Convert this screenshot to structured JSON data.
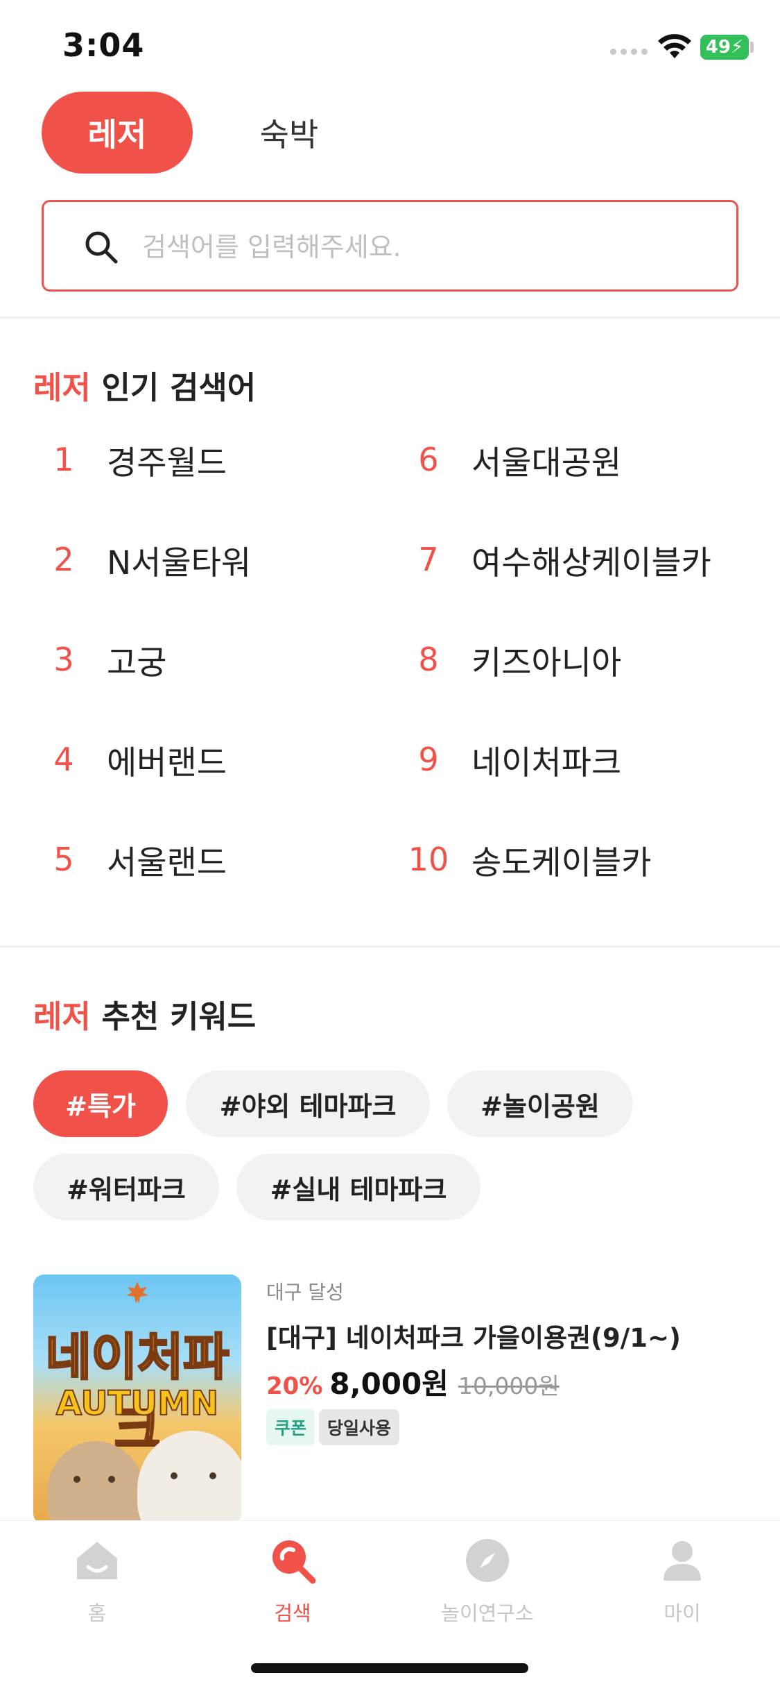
{
  "status_bar": {
    "time": "3:04",
    "battery": "49"
  },
  "top_tabs": [
    {
      "label": "레저",
      "active": true
    },
    {
      "label": "숙박",
      "active": false
    }
  ],
  "search": {
    "placeholder": "검색어를 입력해주세요.",
    "value": ""
  },
  "popular": {
    "title_accent": "레저",
    "title_rest": " 인기 검색어",
    "items": [
      {
        "rank": "1",
        "label": "경주월드"
      },
      {
        "rank": "2",
        "label": "N서울타워"
      },
      {
        "rank": "3",
        "label": "고궁"
      },
      {
        "rank": "4",
        "label": "에버랜드"
      },
      {
        "rank": "5",
        "label": "서울랜드"
      },
      {
        "rank": "6",
        "label": "서울대공원"
      },
      {
        "rank": "7",
        "label": "여수해상케이블카"
      },
      {
        "rank": "8",
        "label": "키즈아니아"
      },
      {
        "rank": "9",
        "label": "네이처파크"
      },
      {
        "rank": "10",
        "label": "송도케이블카"
      }
    ]
  },
  "recommend": {
    "title_accent": "레저",
    "title_rest": " 추천 키워드",
    "chips": [
      {
        "label": "#특가",
        "active": true
      },
      {
        "label": "#야외 테마파크",
        "active": false
      },
      {
        "label": "#놀이공원",
        "active": false
      },
      {
        "label": "#워터파크",
        "active": false
      },
      {
        "label": "#실내 테마파크",
        "active": false
      }
    ]
  },
  "product": {
    "thumb_title": "네이처파크",
    "thumb_subtitle": "AUTUMN",
    "location": "대구 달성",
    "title": "[대구] 네이처파크 가을이용권(9/1~)",
    "discount": "20%",
    "price": "8,000원",
    "original_price": "10,000원",
    "tags": [
      "쿠폰",
      "당일사용"
    ]
  },
  "bottom_nav": [
    {
      "label": "홈",
      "icon": "home-icon",
      "active": false
    },
    {
      "label": "검색",
      "icon": "search-icon",
      "active": true
    },
    {
      "label": "놀이연구소",
      "icon": "compass-icon",
      "active": false
    },
    {
      "label": "마이",
      "icon": "person-icon",
      "active": false
    }
  ],
  "colors": {
    "accent": "#f0524a",
    "inactive": "#c6c6c6",
    "chip_bg": "#f1f2f4"
  }
}
